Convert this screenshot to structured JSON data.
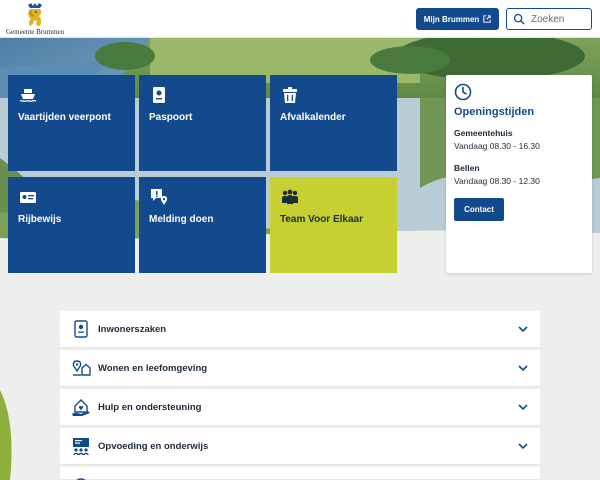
{
  "header": {
    "logo_text": "Gemeente Brummen",
    "mijn_label": "Mijn Brummen",
    "search_placeholder": "Zoeken"
  },
  "tiles": [
    {
      "label": "Vaartijden veerpont",
      "icon": "ferry-icon"
    },
    {
      "label": "Paspoort",
      "icon": "passport-icon"
    },
    {
      "label": "Afvalkalender",
      "icon": "waste-bin-icon"
    },
    {
      "label": "Rijbewijs",
      "icon": "driving-license-icon"
    },
    {
      "label": "Melding doen",
      "icon": "report-location-icon"
    },
    {
      "label": "Team Voor Elkaar",
      "icon": "team-icon"
    }
  ],
  "opening": {
    "title": "Openingstijden",
    "gemeentehuis_label": "Gemeentehuis",
    "gemeentehuis_hours": "Vandaag 08.30 - 16.30",
    "bellen_label": "Bellen",
    "bellen_hours": "Vandaag 08.30 - 12.30",
    "contact_label": "Contact"
  },
  "accordion": [
    {
      "label": "Inwonerszaken",
      "icon": "resident-icon"
    },
    {
      "label": "Wonen en leefomgeving",
      "icon": "living-environment-icon"
    },
    {
      "label": "Hulp en ondersteuning",
      "icon": "support-icon"
    },
    {
      "label": "Opvoeding en onderwijs",
      "icon": "education-icon"
    }
  ],
  "colors": {
    "brand_blue": "#134a8e",
    "accent_lime": "#c6d033",
    "background": "#eeeeec"
  }
}
